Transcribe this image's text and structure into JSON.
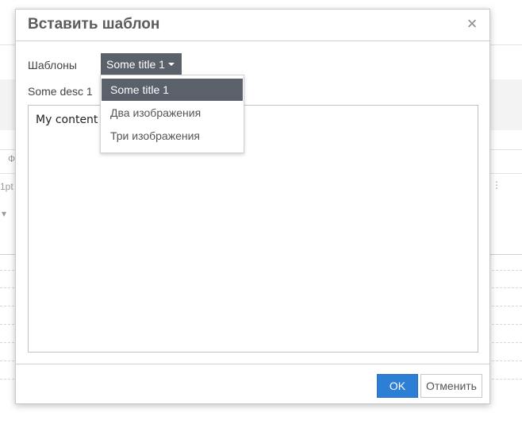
{
  "background": {
    "fragment_1": "Ф",
    "fragment_2": "1pt"
  },
  "dialog": {
    "title": "Вставить шаблон",
    "close_glyph": "×",
    "templates_label": "Шаблоны",
    "selected_template": "Some title 1",
    "description": "Some desc 1",
    "preview_content": "My content",
    "dropdown_options": [
      {
        "label": "Some title 1",
        "active": true
      },
      {
        "label": "Два изображения",
        "active": false
      },
      {
        "label": "Три изображения",
        "active": false
      }
    ],
    "ok_label": "OK",
    "cancel_label": "Отменить"
  },
  "colors": {
    "accent_blue": "#2d7fd6",
    "selected_dark": "#5a616b"
  }
}
